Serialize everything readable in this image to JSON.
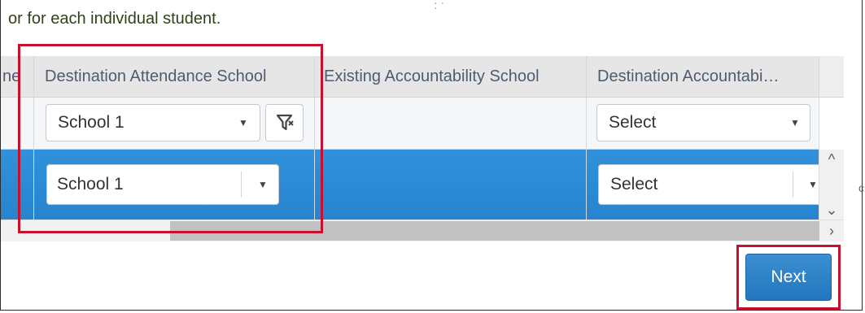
{
  "intro": {
    "text": "or for each individual student."
  },
  "table": {
    "headers": {
      "partial": "ne",
      "destination_attendance_school": "Destination Attendance School",
      "existing_accountability_school": "Existing Accountability School",
      "destination_accountability": "Destination Accountabi…"
    },
    "filter_row": {
      "attendance_select_value": "School 1",
      "accountability_select_value": "Select"
    },
    "data_row": {
      "attendance_select_value": "School 1",
      "accountability_select_value": "Select"
    }
  },
  "scroll": {
    "up": "^",
    "down": "⌄",
    "right": "›"
  },
  "buttons": {
    "next_label": "Next"
  },
  "colors": {
    "selected_row": "#2989d8",
    "highlight_box": "#c8102e",
    "primary_button": "#2a7fc6"
  },
  "icons": [
    "chevron-down-icon",
    "clear-filter-icon",
    "chevron-up-icon",
    "chevron-right-icon"
  ]
}
